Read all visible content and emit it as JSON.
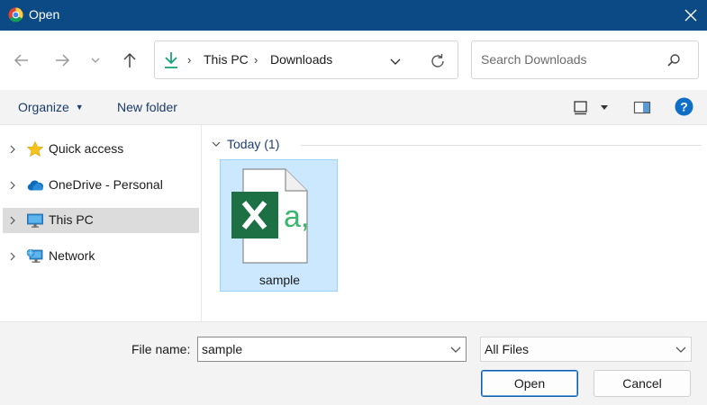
{
  "window": {
    "title": "Open"
  },
  "address": {
    "crumbs": [
      "This PC",
      "Downloads"
    ]
  },
  "search": {
    "placeholder": "Search Downloads"
  },
  "toolbar": {
    "organize_label": "Organize",
    "new_folder_label": "New folder"
  },
  "sidebar": {
    "items": [
      {
        "label": "Quick access",
        "icon": "star-icon"
      },
      {
        "label": "OneDrive - Personal",
        "icon": "cloud-icon"
      },
      {
        "label": "This PC",
        "icon": "monitor-icon",
        "selected": true
      },
      {
        "label": "Network",
        "icon": "network-icon"
      }
    ]
  },
  "content": {
    "group_label": "Today (1)",
    "files": [
      {
        "name": "sample",
        "icon": "excel-file-icon"
      }
    ]
  },
  "bottom": {
    "file_name_label": "File name:",
    "file_name_value": "sample",
    "file_type_value": "All Files",
    "open_label": "Open",
    "cancel_label": "Cancel"
  },
  "colors": {
    "titlebar": "#0b4a85",
    "selection": "#cce8ff",
    "excel_green": "#1d7044",
    "accent": "#0078d4"
  }
}
